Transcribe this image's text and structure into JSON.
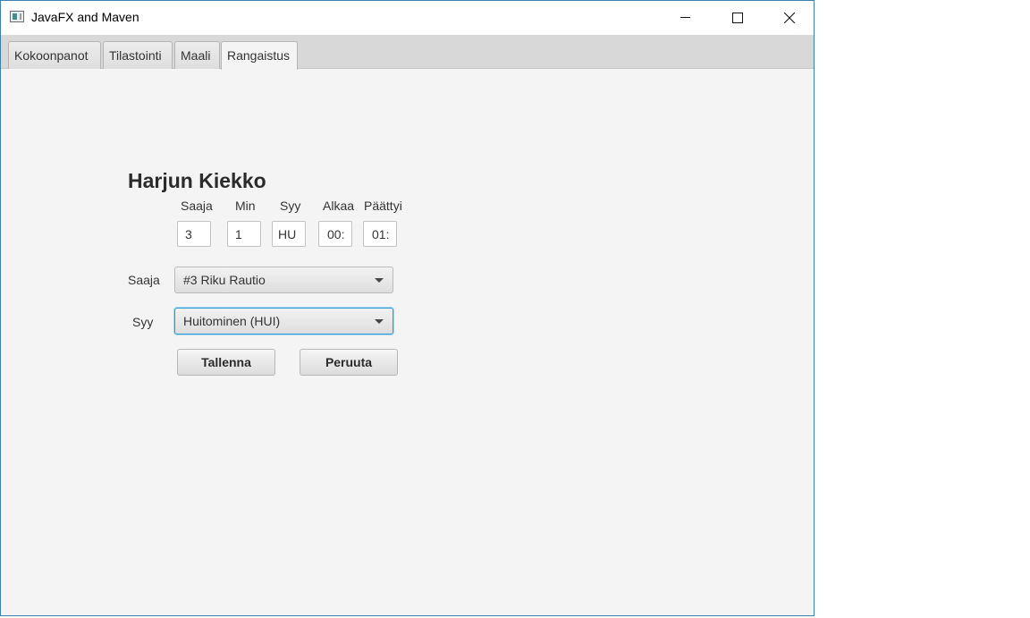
{
  "window": {
    "title": "JavaFX and Maven"
  },
  "tabs": [
    {
      "label": "Kokoonpanot"
    },
    {
      "label": "Tilastointi"
    },
    {
      "label": "Maali"
    },
    {
      "label": "Rangaistus",
      "active": true
    }
  ],
  "form": {
    "team_name": "Harjun Kiekko",
    "columns": {
      "saaja": {
        "label": "Saaja",
        "value": "3"
      },
      "min": {
        "label": "Min",
        "value": "1"
      },
      "syy": {
        "label": "Syy",
        "value": "HU"
      },
      "alkaa": {
        "label": "Alkaa",
        "value": "00:"
      },
      "paattyi": {
        "label": "Päättyi",
        "value": "01:"
      }
    },
    "saaja_label": "Saaja",
    "saaja_selected": "#3 Riku Rautio",
    "syy_label": "Syy",
    "syy_selected": "Huitominen (HUI)",
    "save_label": "Tallenna",
    "cancel_label": "Peruuta"
  },
  "colors": {
    "window_border": "#3c7fb1",
    "focus": "#2a9bd6",
    "background": "#f4f4f4"
  }
}
